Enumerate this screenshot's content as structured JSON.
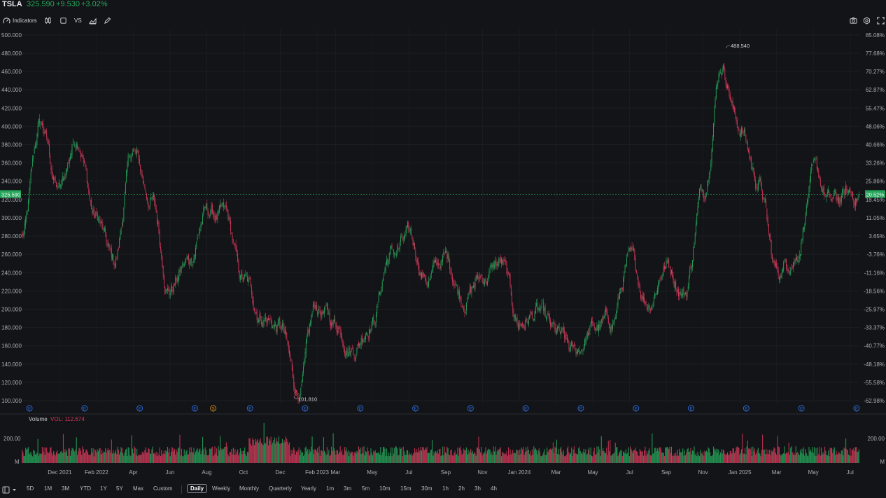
{
  "header": {
    "ticker": "TSLA",
    "price": "325.590",
    "change": "+9.530",
    "change_pct": "+3.02%"
  },
  "toolbar": {
    "indicators_label": "Indicators",
    "compare_label": "VS"
  },
  "colors": {
    "up": "#26a65b",
    "down": "#d6375b",
    "background": "#131417",
    "price_badge": "#26a65b",
    "event_marker": "#2f6de1",
    "split_marker": "#d58a1c"
  },
  "chart_data": {
    "type": "candlestick",
    "ylim": [
      97,
      506
    ],
    "y_ticks": [
      "500.000",
      "480.000",
      "460.000",
      "440.000",
      "420.000",
      "400.000",
      "380.000",
      "360.000",
      "340.000",
      "320.000",
      "300.000",
      "280.000",
      "260.000",
      "240.000",
      "220.000",
      "200.000",
      "180.000",
      "160.000",
      "140.000",
      "120.000",
      "100.000"
    ],
    "y_right_ticks": [
      "85.08%",
      "77.68%",
      "70.27%",
      "62.87%",
      "55.47%",
      "48.06%",
      "40.66%",
      "33.26%",
      "25.86%",
      "18.45%",
      "11.05%",
      "3.65%",
      "-3.76%",
      "-11.16%",
      "-18.56%",
      "-25.97%",
      "-33.37%",
      "-40.77%",
      "-48.18%",
      "-55.58%",
      "-62.98%"
    ],
    "x_ticks": [
      "Dec 2021",
      "Feb 2022",
      "Apr",
      "Jun",
      "Aug",
      "Oct",
      "Dec",
      "Feb 2023",
      "Mar",
      "May",
      "Jul",
      "Sep",
      "Nov",
      "Jan 2024",
      "Mar",
      "May",
      "Jul",
      "Sep",
      "Nov",
      "Jan 2025",
      "Mar",
      "May",
      "Jul"
    ],
    "current_price": 325.59,
    "current_price_label": "325.590",
    "current_pct_label": "20.52%",
    "annotations": [
      {
        "label": "488.540",
        "value": 488.54
      },
      {
        "label": "101.810",
        "value": 101.81
      }
    ],
    "price_path": [
      {
        "date": "Oct 2021",
        "close": 280
      },
      {
        "date": "Nov 2021",
        "close": 400
      },
      {
        "date": "Dec 2021",
        "close": 330
      },
      {
        "date": "Jan 2022",
        "close": 390
      },
      {
        "date": "Feb 2022",
        "close": 300
      },
      {
        "date": "Mar 2022",
        "close": 250
      },
      {
        "date": "Apr 2022",
        "close": 370
      },
      {
        "date": "May 2022",
        "close": 320
      },
      {
        "date": "Jun 2022",
        "close": 225
      },
      {
        "date": "Jul 2022",
        "close": 250
      },
      {
        "date": "Aug 2022",
        "close": 305
      },
      {
        "date": "Sep 2022",
        "close": 300
      },
      {
        "date": "Oct 2022",
        "close": 230
      },
      {
        "date": "Nov 2022",
        "close": 195
      },
      {
        "date": "Dec 2022",
        "close": 180
      },
      {
        "date": "Jan 2023",
        "close": 110
      },
      {
        "date": "Feb 2023",
        "close": 200
      },
      {
        "date": "Mar 2023",
        "close": 185
      },
      {
        "date": "Apr 2023",
        "close": 160
      },
      {
        "date": "May 2023",
        "close": 190
      },
      {
        "date": "Jun 2023",
        "close": 260
      },
      {
        "date": "Jul 2023",
        "close": 275
      },
      {
        "date": "Aug 2023",
        "close": 235
      },
      {
        "date": "Sep 2023",
        "close": 255
      },
      {
        "date": "Oct 2023",
        "close": 215
      },
      {
        "date": "Nov 2023",
        "close": 235
      },
      {
        "date": "Dec 2023",
        "close": 250
      },
      {
        "date": "Jan 2024",
        "close": 185
      },
      {
        "date": "Feb 2024",
        "close": 195
      },
      {
        "date": "Mar 2024",
        "close": 170
      },
      {
        "date": "Apr 2024",
        "close": 150
      },
      {
        "date": "May 2024",
        "close": 178
      },
      {
        "date": "Jun 2024",
        "close": 185
      },
      {
        "date": "Jul 2024",
        "close": 250
      },
      {
        "date": "Aug 2024",
        "close": 210
      },
      {
        "date": "Sep 2024",
        "close": 250
      },
      {
        "date": "Oct 2024",
        "close": 220
      },
      {
        "date": "Nov 2024",
        "close": 330
      },
      {
        "date": "Dec 2024",
        "close": 470
      },
      {
        "date": "Jan 2025",
        "close": 400
      },
      {
        "date": "Feb 2025",
        "close": 340
      },
      {
        "date": "Mar 2025",
        "close": 240
      },
      {
        "date": "Apr 2025",
        "close": 260
      },
      {
        "date": "May 2025",
        "close": 345
      },
      {
        "date": "Jun 2025",
        "close": 315
      },
      {
        "date": "Jul 2025",
        "close": 325
      }
    ],
    "events": [
      {
        "date": "Oct 2021",
        "type": "E"
      },
      {
        "date": "Jan 2022",
        "type": "E"
      },
      {
        "date": "Apr 2022",
        "type": "E"
      },
      {
        "date": "Jul 2022",
        "type": "E"
      },
      {
        "date": "Aug 2022",
        "type": "S"
      },
      {
        "date": "Oct 2022",
        "type": "E"
      },
      {
        "date": "Jan 2023",
        "type": "E"
      },
      {
        "date": "Apr 2023",
        "type": "E"
      },
      {
        "date": "Jul 2023",
        "type": "E"
      },
      {
        "date": "Oct 2023",
        "type": "E"
      },
      {
        "date": "Jan 2024",
        "type": "E"
      },
      {
        "date": "Apr 2024",
        "type": "E"
      },
      {
        "date": "Jul 2024",
        "type": "E"
      },
      {
        "date": "Oct 2024",
        "type": "E"
      },
      {
        "date": "Jan 2025",
        "type": "E"
      },
      {
        "date": "Apr 2025",
        "type": "E"
      },
      {
        "date": "Jul 2025",
        "type": "E"
      }
    ],
    "volume": {
      "label": "Volume",
      "value_label": "VOL: 112.674",
      "ylim": [
        0,
        260
      ],
      "y_ticks": [
        "200.00",
        "M"
      ]
    }
  },
  "bottom": {
    "ranges": [
      "5D",
      "1M",
      "3M",
      "YTD",
      "1Y",
      "5Y",
      "Max",
      "Custom"
    ],
    "intervals": [
      "Daily",
      "Weekly",
      "Monthly",
      "Quarterly",
      "Yearly",
      "1m",
      "3m",
      "5m",
      "10m",
      "15m",
      "30m",
      "1h",
      "2h",
      "3h",
      "4h"
    ],
    "active_interval": "Daily"
  }
}
